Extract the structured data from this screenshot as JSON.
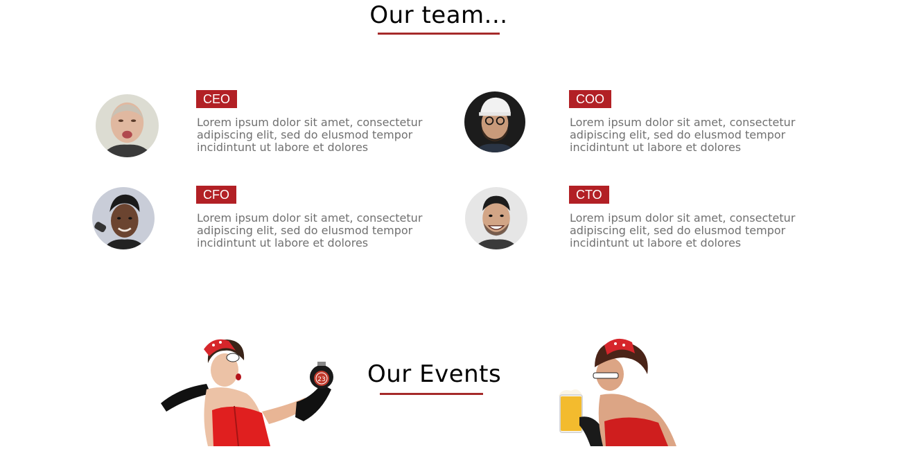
{
  "team": {
    "title": "Our team...",
    "members": [
      {
        "role": "CEO",
        "description": "Lorem ipsum dolor sit amet, consectetur adipiscing elit, sed do elusmod tempor incidintunt ut labore et dolores"
      },
      {
        "role": "COO",
        "description": "Lorem ipsum dolor sit amet, consectetur adipiscing elit, sed do elusmod tempor incidintunt ut labore et dolores"
      },
      {
        "role": "CFO",
        "description": "Lorem ipsum dolor sit amet, consectetur adipiscing elit, sed do elusmod tempor incidintunt ut labore et dolores"
      },
      {
        "role": "CTO",
        "description": "Lorem ipsum dolor sit amet, consectetur adipiscing elit, sed do elusmod tempor incidintunt ut labore et dolores"
      }
    ]
  },
  "events": {
    "title": "Our Events",
    "clock_number": "23"
  },
  "colors": {
    "accent": "#b22025",
    "underline": "#a52a2a",
    "text_muted": "#707070"
  }
}
